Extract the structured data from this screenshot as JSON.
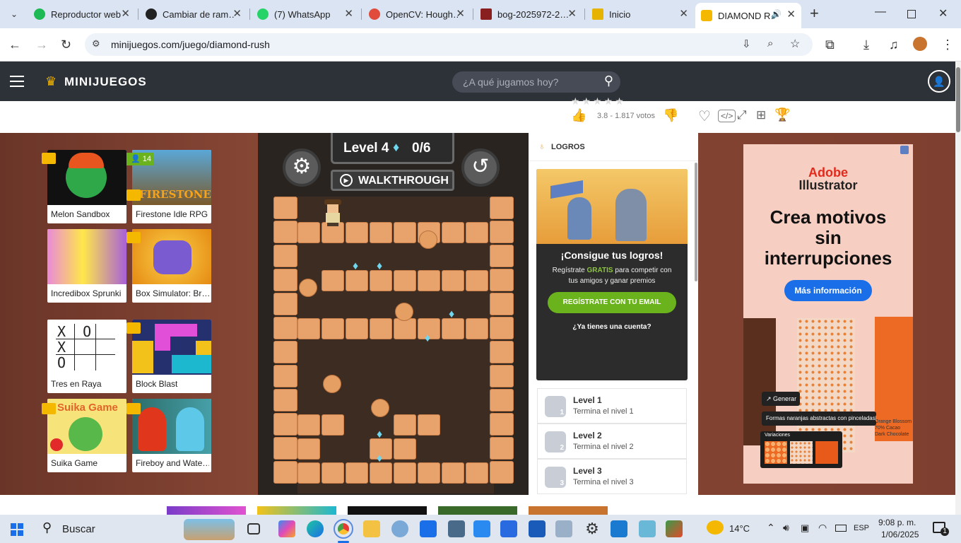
{
  "browser": {
    "tabs": [
      {
        "title": "Reproductor web",
        "color": "#1db954"
      },
      {
        "title": "Cambiar de ram…",
        "color": "#222222"
      },
      {
        "title": "(7) WhatsApp",
        "color": "#25d366"
      },
      {
        "title": "OpenCV: Hough…",
        "color": "#e04b3c"
      },
      {
        "title": "bog-2025972-2…",
        "color": "#8a1f1f"
      },
      {
        "title": "Inicio",
        "color": "#e6b400"
      },
      {
        "title": "DIAMOND R…",
        "color": "#f5b800"
      }
    ],
    "new_tab": "+",
    "url": "minijuegos.com/juego/diamond-rush"
  },
  "site": {
    "logo": "MINIJUEGOS",
    "search_placeholder": "¿A qué jugamos hoy?",
    "rating_text": "3.8 - 1.817 votos"
  },
  "games": [
    {
      "label": "Melon Sandbox",
      "color": "#1a1a1a"
    },
    {
      "label": "Firestone Idle RPG",
      "color": "#4a8fbf",
      "badge": "14"
    },
    {
      "label": "Incredibox Sprunki",
      "color": "#c86ad8"
    },
    {
      "label": "Box Simulator: Br…",
      "color": "#f0a020"
    },
    {
      "label": "Tres en Raya",
      "color": "#ffffff"
    },
    {
      "label": "Block Blast",
      "color": "#2a3a8a"
    },
    {
      "label": "Suika Game",
      "color": "#f4e06a"
    },
    {
      "label": "Fireboy and Wate…",
      "color": "#3a9a8a"
    }
  ],
  "game": {
    "level_text": "Level 4",
    "gem_count": "0/6",
    "walkthrough": "WALKTHROUGH"
  },
  "logros": {
    "header": "LOGROS",
    "promo_title": "¡Consigue tus logros!",
    "promo_line1_pre": "Regístrate ",
    "promo_line1_hl": "GRATIS",
    "promo_line1_post": " para competir con",
    "promo_line2": "tus amigos y ganar premios",
    "cta": "REGÍSTRATE CON TU EMAIL",
    "account": "¿Ya tienes una cuenta?",
    "levels": [
      {
        "title": "Level 1",
        "subtitle": "Termina el nivel 1",
        "num": "1"
      },
      {
        "title": "Level 2",
        "subtitle": "Termina el nivel 2",
        "num": "2"
      },
      {
        "title": "Level 3",
        "subtitle": "Termina el nivel 3",
        "num": "3"
      }
    ]
  },
  "ad": {
    "brand1": "Adobe",
    "brand2": "Illustrator",
    "headline1": "Crea motivos",
    "headline2": "sin",
    "headline3": "interrupciones",
    "button": "Más información",
    "generate": "Generar",
    "prompt": "Formas naranjas abstractas con pinceladas|",
    "variations": "Variaciones",
    "choc1": "Orange Blossom",
    "choc2": "70% Cacao",
    "choc3": "Dark Chocolate"
  },
  "taskbar": {
    "search": "Buscar",
    "weather": "14°C",
    "lang": "ESP",
    "time": "9:08 p. m.",
    "date": "1/06/2025",
    "notif": "1"
  }
}
